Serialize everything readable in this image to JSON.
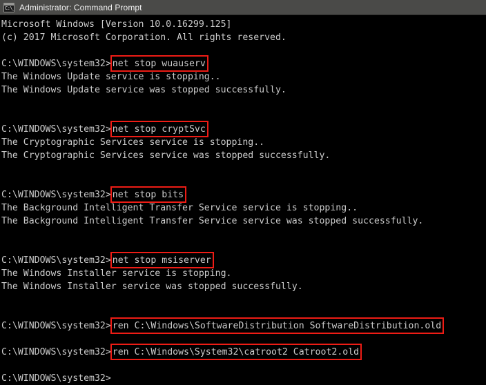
{
  "window": {
    "title": "Administrator: Command Prompt",
    "icon_name": "command-prompt-icon",
    "icon_glyph": "C:\\_",
    "titlebar_color": "#4a4a48",
    "background_color": "#000000",
    "text_color": "#cccccc",
    "highlight_color": "#ee1c15"
  },
  "console": {
    "prompt": "C:\\WINDOWS\\system32>",
    "lines": [
      {
        "type": "output",
        "text": "Microsoft Windows [Version 10.0.16299.125]"
      },
      {
        "type": "output",
        "text": "(c) 2017 Microsoft Corporation. All rights reserved."
      },
      {
        "type": "blank",
        "text": ""
      },
      {
        "type": "command",
        "prompt": "C:\\WINDOWS\\system32>",
        "command": "net stop wuauserv",
        "highlighted": true
      },
      {
        "type": "output",
        "text": "The Windows Update service is stopping.."
      },
      {
        "type": "output",
        "text": "The Windows Update service was stopped successfully."
      },
      {
        "type": "blank",
        "text": ""
      },
      {
        "type": "blank",
        "text": ""
      },
      {
        "type": "command",
        "prompt": "C:\\WINDOWS\\system32>",
        "command": "net stop cryptSvc",
        "highlighted": true
      },
      {
        "type": "output",
        "text": "The Cryptographic Services service is stopping.."
      },
      {
        "type": "output",
        "text": "The Cryptographic Services service was stopped successfully."
      },
      {
        "type": "blank",
        "text": ""
      },
      {
        "type": "blank",
        "text": ""
      },
      {
        "type": "command",
        "prompt": "C:\\WINDOWS\\system32>",
        "command": "net stop bits",
        "highlighted": true
      },
      {
        "type": "output",
        "text": "The Background Intelligent Transfer Service service is stopping.."
      },
      {
        "type": "output",
        "text": "The Background Intelligent Transfer Service service was stopped successfully."
      },
      {
        "type": "blank",
        "text": ""
      },
      {
        "type": "blank",
        "text": ""
      },
      {
        "type": "command",
        "prompt": "C:\\WINDOWS\\system32>",
        "command": "net stop msiserver",
        "highlighted": true
      },
      {
        "type": "output",
        "text": "The Windows Installer service is stopping."
      },
      {
        "type": "output",
        "text": "The Windows Installer service was stopped successfully."
      },
      {
        "type": "blank",
        "text": ""
      },
      {
        "type": "blank",
        "text": ""
      },
      {
        "type": "command",
        "prompt": "C:\\WINDOWS\\system32>",
        "command": "ren C:\\Windows\\SoftwareDistribution SoftwareDistribution.old",
        "highlighted": true
      },
      {
        "type": "blank",
        "text": ""
      },
      {
        "type": "command",
        "prompt": "C:\\WINDOWS\\system32>",
        "command": "ren C:\\Windows\\System32\\catroot2 Catroot2.old",
        "highlighted": true
      },
      {
        "type": "blank",
        "text": ""
      },
      {
        "type": "command",
        "prompt": "C:\\WINDOWS\\system32>",
        "command": "",
        "highlighted": false
      }
    ]
  }
}
